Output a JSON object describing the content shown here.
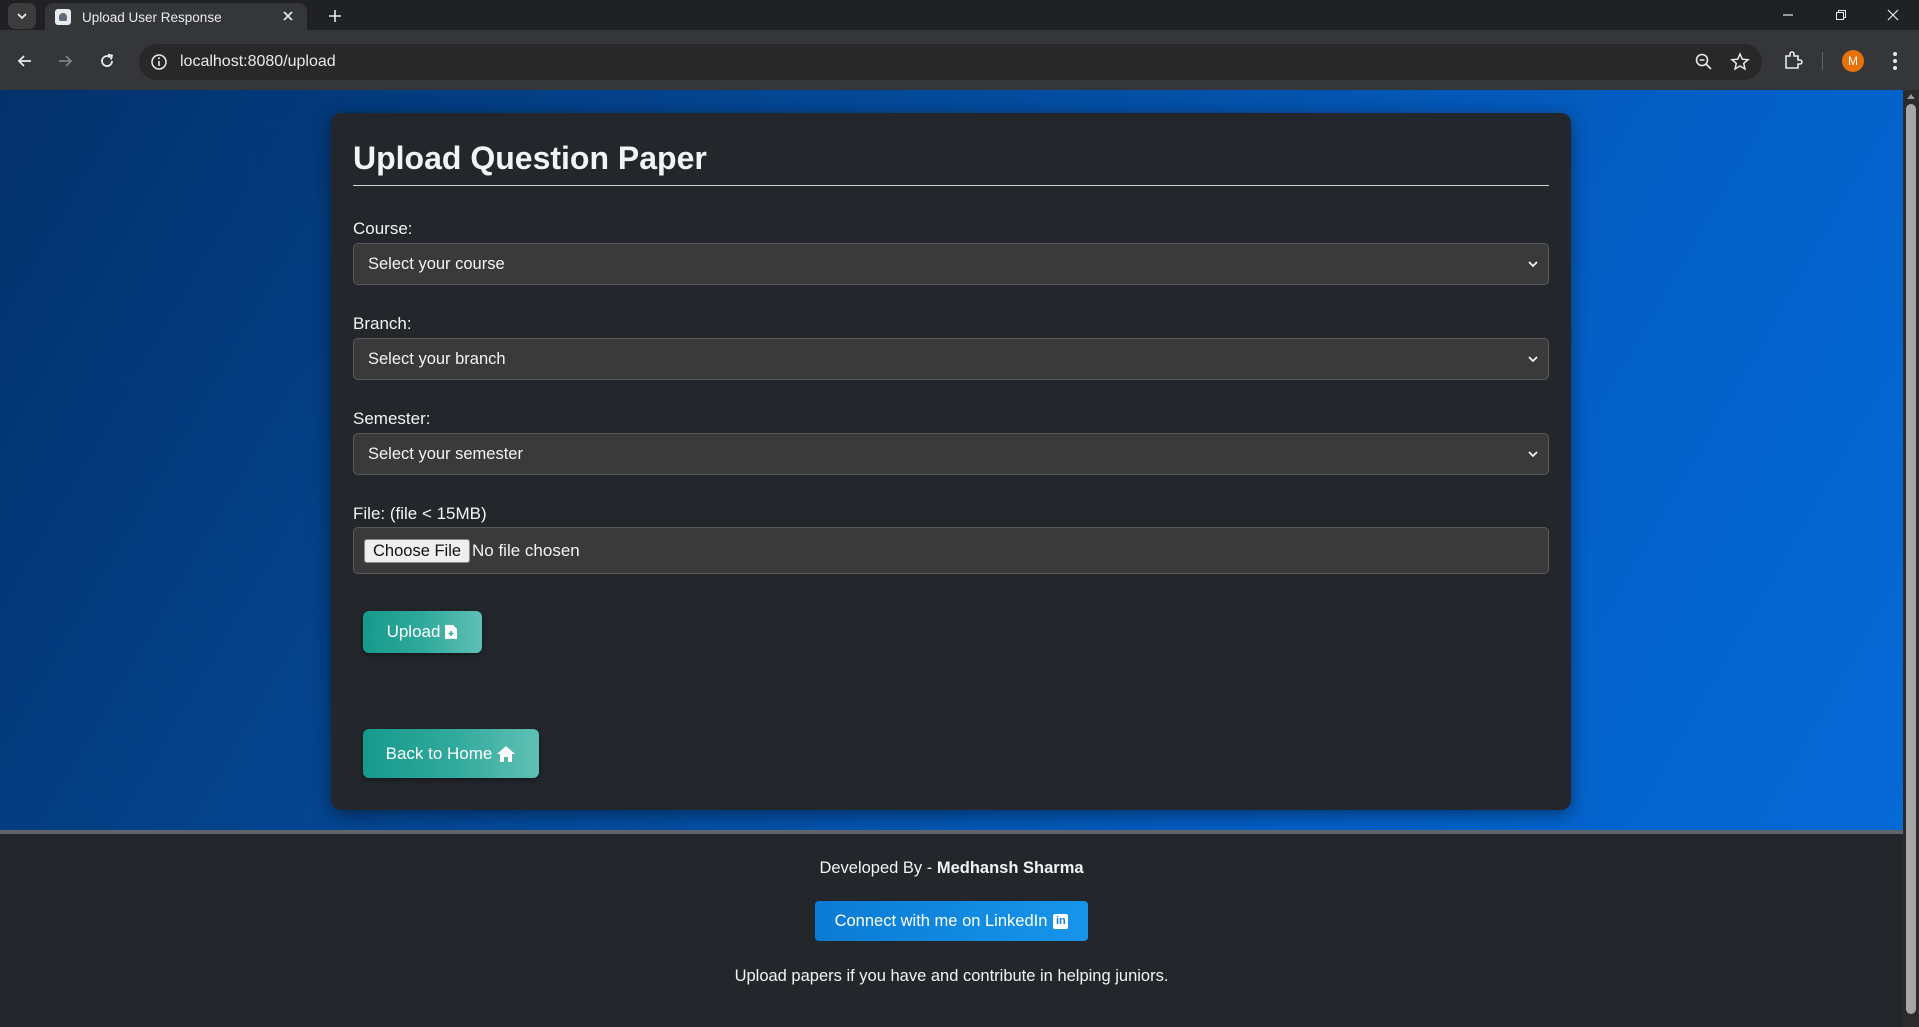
{
  "browser": {
    "tab_title": "Upload User Response",
    "url": "localhost:8080/upload",
    "profile_initial": "M"
  },
  "page": {
    "title": "Upload Question Paper",
    "fields": {
      "course": {
        "label": "Course:",
        "selected": "Select your course"
      },
      "branch": {
        "label": "Branch:",
        "selected": "Select your branch"
      },
      "semester": {
        "label": "Semester:",
        "selected": "Select your semester"
      },
      "file": {
        "label": "File: (file < 15MB)",
        "button": "Choose File",
        "status": "No file chosen"
      }
    },
    "upload_button": "Upload",
    "home_button": "Back to Home"
  },
  "footer": {
    "developed_by": "Developed By - ",
    "developer_name": "Medhansh Sharma",
    "linkedin_button": "Connect with me on LinkedIn",
    "note": "Upload papers if you have and contribute in helping juniors."
  },
  "colors": {
    "accent_teal": "#169a8c",
    "linkedin_blue": "#0a7bd4",
    "card_bg": "#23272c"
  }
}
